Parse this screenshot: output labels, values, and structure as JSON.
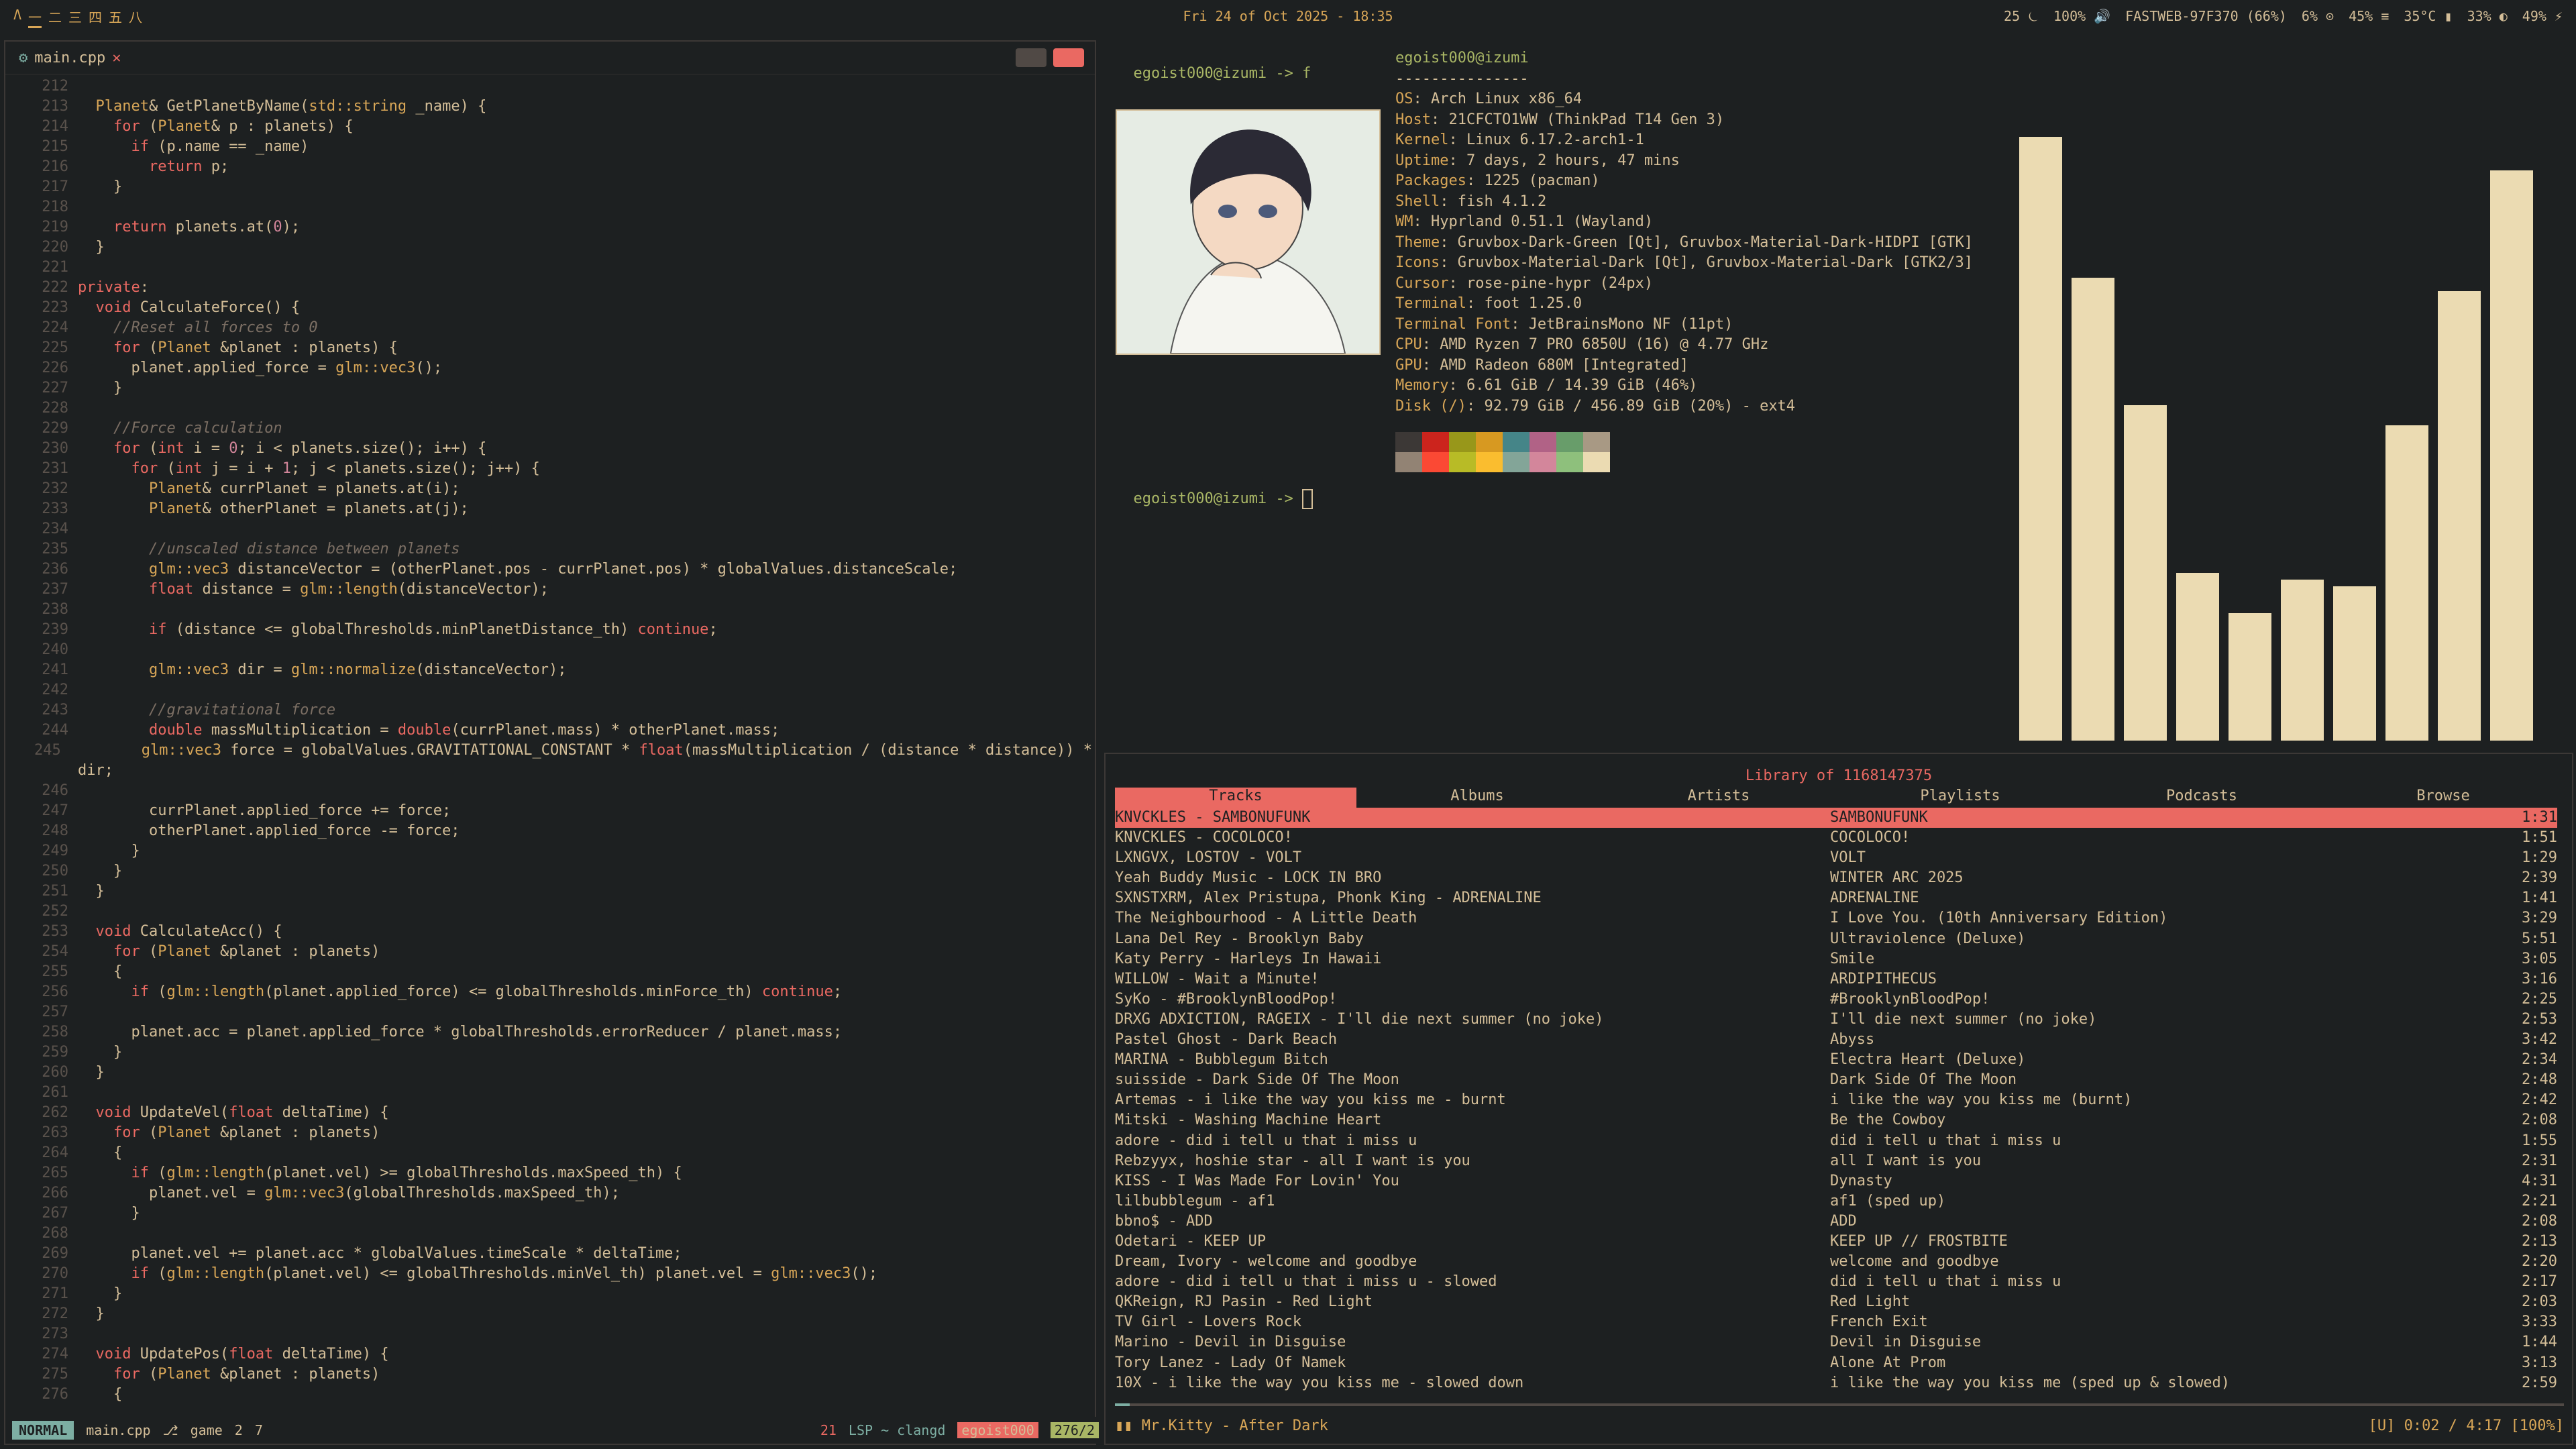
{
  "bar": {
    "arch_icon": "arch-linux-icon",
    "workspaces": [
      "一",
      "二",
      "三",
      "四",
      "五",
      "八"
    ],
    "clock": "Fri 24 of Oct 2025 - 18:35",
    "stats": [
      "25 ⏾",
      "100% 🔊",
      "FASTWEB-97F370 (66%)",
      "6% ⊙",
      "45% ≡",
      "35°C ▮",
      "33% ◐",
      "49% ⚡"
    ]
  },
  "editor": {
    "tab": "main.cpp",
    "status": {
      "mode": "NORMAL",
      "file": "main.cpp",
      "branch": "game",
      "add": "2",
      "mod": "7",
      "errors": "21",
      "lsp": "LSP ~ clangd",
      "user": "egoist000",
      "pos": "276/2"
    },
    "lines": [
      [
        "212",
        ""
      ],
      [
        "213",
        "  Planet& GetPlanetByName(std::string _name) {"
      ],
      [
        "214",
        "    for (Planet& p : planets) {"
      ],
      [
        "215",
        "      if (p.name == _name)"
      ],
      [
        "216",
        "        return p;"
      ],
      [
        "217",
        "    }"
      ],
      [
        "218",
        ""
      ],
      [
        "219",
        "    return planets.at(0);"
      ],
      [
        "220",
        "  }"
      ],
      [
        "221",
        ""
      ],
      [
        "222",
        "private:"
      ],
      [
        "223",
        "  void CalculateForce() {"
      ],
      [
        "224",
        "    //Reset all forces to 0"
      ],
      [
        "225",
        "    for (Planet &planet : planets) {"
      ],
      [
        "226",
        "      planet.applied_force = glm::vec3();"
      ],
      [
        "227",
        "    }"
      ],
      [
        "228",
        ""
      ],
      [
        "229",
        "    //Force calculation"
      ],
      [
        "230",
        "    for (int i = 0; i < planets.size(); i++) {"
      ],
      [
        "231",
        "      for (int j = i + 1; j < planets.size(); j++) {"
      ],
      [
        "232",
        "        Planet& currPlanet = planets.at(i);"
      ],
      [
        "233",
        "        Planet& otherPlanet = planets.at(j);"
      ],
      [
        "234",
        ""
      ],
      [
        "235",
        "        //unscaled distance between planets"
      ],
      [
        "236",
        "        glm::vec3 distanceVector = (otherPlanet.pos - currPlanet.pos) * globalValues.distanceScale;"
      ],
      [
        "237",
        "        float distance = glm::length(distanceVector);"
      ],
      [
        "238",
        ""
      ],
      [
        "239",
        "        if (distance <= globalThresholds.minPlanetDistance_th) continue;"
      ],
      [
        "240",
        ""
      ],
      [
        "241",
        "        glm::vec3 dir = glm::normalize(distanceVector);"
      ],
      [
        "242",
        ""
      ],
      [
        "243",
        "        //gravitational force"
      ],
      [
        "244",
        "        double massMultiplication = double(currPlanet.mass) * otherPlanet.mass;"
      ],
      [
        "245",
        "        glm::vec3 force = globalValues.GRAVITATIONAL_CONSTANT * float(massMultiplication / (distance * distance)) *"
      ],
      [
        "",
        "dir;"
      ],
      [
        "246",
        ""
      ],
      [
        "247",
        "        currPlanet.applied_force += force;"
      ],
      [
        "248",
        "        otherPlanet.applied_force -= force;"
      ],
      [
        "249",
        "      }"
      ],
      [
        "250",
        "    }"
      ],
      [
        "251",
        "  }"
      ],
      [
        "252",
        ""
      ],
      [
        "253",
        "  void CalculateAcc() {"
      ],
      [
        "254",
        "    for (Planet &planet : planets)"
      ],
      [
        "255",
        "    {"
      ],
      [
        "256",
        "      if (glm::length(planet.applied_force) <= globalThresholds.minForce_th) continue;"
      ],
      [
        "257",
        ""
      ],
      [
        "258",
        "      planet.acc = planet.applied_force * globalThresholds.errorReducer / planet.mass;"
      ],
      [
        "259",
        "    }"
      ],
      [
        "260",
        "  }"
      ],
      [
        "261",
        ""
      ],
      [
        "262",
        "  void UpdateVel(float deltaTime) {"
      ],
      [
        "263",
        "    for (Planet &planet : planets)"
      ],
      [
        "264",
        "    {"
      ],
      [
        "265",
        "      if (glm::length(planet.vel) >= globalThresholds.maxSpeed_th) {"
      ],
      [
        "266",
        "        planet.vel = glm::vec3(globalThresholds.maxSpeed_th);"
      ],
      [
        "267",
        "      }"
      ],
      [
        "268",
        ""
      ],
      [
        "269",
        "      planet.vel += planet.acc * globalValues.timeScale * deltaTime;"
      ],
      [
        "270",
        "      if (glm::length(planet.vel) <= globalThresholds.minVel_th) planet.vel = glm::vec3();"
      ],
      [
        "271",
        "    }"
      ],
      [
        "272",
        "  }"
      ],
      [
        "273",
        ""
      ],
      [
        "274",
        "  void UpdatePos(float deltaTime) {"
      ],
      [
        "275",
        "    for (Planet &planet : planets)"
      ],
      [
        "276",
        "    {"
      ]
    ]
  },
  "terminal": {
    "prompt1": "egoist000@izumi -> f",
    "prompt2": "egoist000@izumi -> ",
    "header": "egoist000@izumi",
    "sep": "---------------",
    "info": [
      [
        "OS",
        "Arch Linux x86_64"
      ],
      [
        "Host",
        "21CFCTO1WW (ThinkPad T14 Gen 3)"
      ],
      [
        "Kernel",
        "Linux 6.17.2-arch1-1"
      ],
      [
        "Uptime",
        "7 days, 2 hours, 47 mins"
      ],
      [
        "Packages",
        "1225 (pacman)"
      ],
      [
        "Shell",
        "fish 4.1.2"
      ],
      [
        "WM",
        "Hyprland 0.51.1 (Wayland)"
      ],
      [
        "Theme",
        "Gruvbox-Dark-Green [Qt], Gruvbox-Material-Dark-HIDPI [GTK]"
      ],
      [
        "Icons",
        "Gruvbox-Material-Dark [Qt], Gruvbox-Material-Dark [GTK2/3]"
      ],
      [
        "Cursor",
        "rose-pine-hypr (24px)"
      ],
      [
        "Terminal",
        "foot 1.25.0"
      ],
      [
        "Terminal Font",
        "JetBrainsMono NF (11pt)"
      ],
      [
        "CPU",
        "AMD Ryzen 7 PRO 6850U (16) @ 4.77 GHz"
      ],
      [
        "GPU",
        "AMD Radeon 680M [Integrated]"
      ],
      [
        "Memory",
        "6.61 GiB / 14.39 GiB (46%)"
      ],
      [
        "Disk (/)",
        "92.79 GiB / 456.89 GiB (20%) - ext4"
      ]
    ],
    "palette": [
      "#3c3836",
      "#cc241d",
      "#98971a",
      "#d79921",
      "#458588",
      "#b16286",
      "#689d6a",
      "#a89984",
      "#928374",
      "#fb4934",
      "#b8bb26",
      "#fabd2f",
      "#83a598",
      "#d3869b",
      "#8ec07c",
      "#ebdbb2"
    ]
  },
  "visualizer": {
    "levels": [
      0.9,
      0.69,
      0.5,
      0.25,
      0.19,
      0.24,
      0.23,
      0.47,
      0.67,
      0.85
    ]
  },
  "music": {
    "title": "Library of 1168147375",
    "tabs": [
      "Tracks",
      "Albums",
      "Artists",
      "Playlists",
      "Podcasts",
      "Browse"
    ],
    "tracks": [
      [
        "KNVCKLES - SAMBONUFUNK",
        "SAMBONUFUNK",
        "1:31"
      ],
      [
        "KNVCKLES - COCOLOCO!",
        "COCOLOCO!",
        "1:51"
      ],
      [
        "LXNGVX, LOSTOV - VOLT",
        "VOLT",
        "1:29"
      ],
      [
        "Yeah Buddy Music - LOCK IN BRO",
        "WINTER ARC 2025",
        "2:39"
      ],
      [
        "SXNSTXRM, Alex Pristupa, Phonk King - ADRENALINE",
        "ADRENALINE",
        "1:41"
      ],
      [
        "The Neighbourhood - A Little Death",
        "I Love You. (10th Anniversary Edition)",
        "3:29"
      ],
      [
        "Lana Del Rey - Brooklyn Baby",
        "Ultraviolence (Deluxe)",
        "5:51"
      ],
      [
        "Katy Perry - Harleys In Hawaii",
        "Smile",
        "3:05"
      ],
      [
        "WILLOW - Wait a Minute!",
        "ARDIPITHECUS",
        "3:16"
      ],
      [
        "SyKo - #BrooklynBloodPop!",
        "#BrooklynBloodPop!",
        "2:25"
      ],
      [
        "DRXG ADXICTION, RAGEIX - I'll die next summer (no joke)",
        "I'll die next summer (no joke)",
        "2:53"
      ],
      [
        "Pastel Ghost - Dark Beach",
        "Abyss",
        "3:42"
      ],
      [
        "MARINA - Bubblegum Bitch",
        "Electra Heart (Deluxe)",
        "2:34"
      ],
      [
        "suisside - Dark Side Of The Moon",
        "Dark Side Of The Moon",
        "2:48"
      ],
      [
        "Artemas - i like the way you kiss me - burnt",
        "i like the way you kiss me (burnt)",
        "2:42"
      ],
      [
        "Mitski - Washing Machine Heart",
        "Be the Cowboy",
        "2:08"
      ],
      [
        "adore - did i tell u that i miss u",
        "did i tell u that i miss u",
        "1:55"
      ],
      [
        "Rebzyyx, hoshie star - all I want is you",
        "all I want is you",
        "2:31"
      ],
      [
        "KISS - I Was Made For Lovin' You",
        "Dynasty",
        "4:31"
      ],
      [
        "lilbubblegum - af1",
        "af1 (sped up)",
        "2:21"
      ],
      [
        "bbno$ - ADD",
        "ADD",
        "2:08"
      ],
      [
        "Odetari - KEEP UP",
        "KEEP UP // FROSTBITE",
        "2:13"
      ],
      [
        "Dream, Ivory - welcome and goodbye",
        "welcome and goodbye",
        "2:20"
      ],
      [
        "adore - did i tell u that i miss u - slowed",
        "did i tell u that i miss u",
        "2:17"
      ],
      [
        "QKReign, RJ Pasin - Red Light",
        "Red Light",
        "2:03"
      ],
      [
        "TV Girl - Lovers Rock",
        "French Exit",
        "3:33"
      ],
      [
        "Marino - Devil in Disguise",
        "Devil in Disguise",
        "1:44"
      ],
      [
        "Tory Lanez - Lady Of Namek",
        "Alone At Prom",
        "3:13"
      ],
      [
        "10X - i like the way you kiss me - slowed down",
        "i like the way you kiss me (sped up & slowed)",
        "2:59"
      ]
    ],
    "now_playing": "▮▮ Mr.Kitty - After Dark",
    "progress_text": "[U] 0:02 / 4:17 [100%]",
    "progress": 0.01
  }
}
